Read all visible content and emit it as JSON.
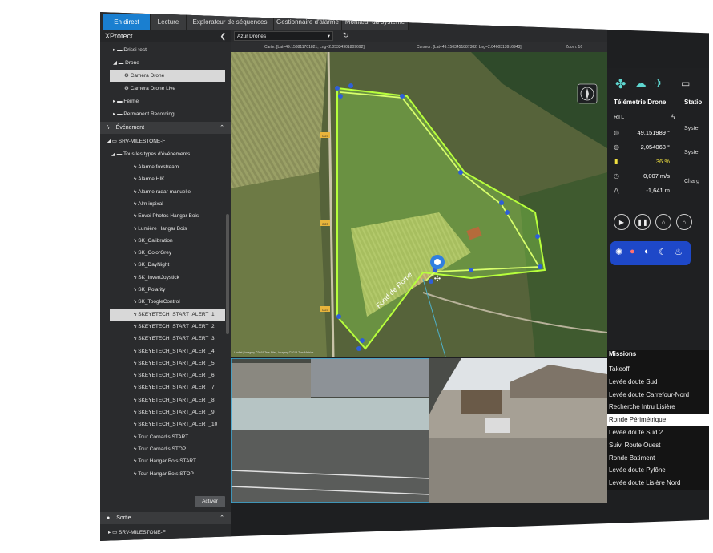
{
  "tabs": [
    "En direct",
    "Lecture",
    "Explorateur de séquences",
    "Gestionnaire d'alarme",
    "Moniteur du système"
  ],
  "app_title": "XProtect",
  "tree": {
    "top_items": [
      "Drissi test",
      "Drone",
      "Caméra Drone",
      "Caméra Drone Live",
      "Ferme",
      "Permanent Recording"
    ],
    "evenement_header": "Événement",
    "server": "SRV-MILESTONE-F",
    "all_events": "Tous les types d'événements",
    "events": [
      "Alarme foxstream",
      "Alarme HIK",
      "Alarme radar manuelle",
      "Alm inpixal",
      "Envoi Photos Hangar Bois",
      "Lumière Hangar Bois",
      "SK_Calibration",
      "SK_ColorGrey",
      "SK_DayNight",
      "SK_InvertJoystick",
      "SK_Polarity",
      "SK_ToogleControl",
      "SKEYETECH_START_ALERT_1",
      "SKEYETECH_START_ALERT_2",
      "SKEYETECH_START_ALERT_3",
      "SKEYETECH_START_ALERT_4",
      "SKEYETECH_START_ALERT_5",
      "SKEYETECH_START_ALERT_6",
      "SKEYETECH_START_ALERT_7",
      "SKEYETECH_START_ALERT_8",
      "SKEYETECH_START_ALERT_9",
      "SKEYETECH_START_ALERT_10",
      "Tour Cornadis START",
      "Tour Cornadis STOP",
      "Tour Hangar Bois START",
      "Tour Hangar Bois STOP"
    ],
    "activate_button": "Activer",
    "sortie_header": "Sortie",
    "sortie_server": "SRV-MILESTONE-F"
  },
  "map": {
    "view_select": "Azur Drones",
    "carte_coords": "Carte: [Lat=49.153811701821, Lng=2.05334901809692]",
    "curseur_coords": "Curseur: [Lat=49.1503451887382, Lng=2.0460313916943]",
    "zoom": "Zoom: 16",
    "road_label": "Fond de Rome",
    "road_badges": [
      "D23",
      "D23",
      "D23"
    ],
    "attribution": "Leaflet | Imagery ©2019 Tele Atlas, Imagery ©2019 TerraMetrics"
  },
  "telemetry": {
    "title": "Télémetrie Drone",
    "station_title": "Statio",
    "mode": "RTL",
    "latitude": "49,151989 °",
    "longitude": "2,054068 °",
    "battery": "36 %",
    "speed": "0,007 m/s",
    "altitude": "-1,641 m",
    "station_labels": [
      "Syste",
      "Syste",
      "Charg"
    ]
  },
  "missions": {
    "header": "Missions",
    "items": [
      "Takeoff",
      "Levée doute Sud",
      "Levée doute Carrefour-Nord",
      "Recherche Intru Lisière",
      "Ronde Périmétrique",
      "Levée doute Sud 2",
      "Suivi Route Ouest",
      "Ronde Batiment",
      "Levée doute Pylône",
      "Levée doute Lisière Nord"
    ],
    "selected_index": 4
  },
  "colors": {
    "accent": "#1a7fd0",
    "perimeter": "#b7ff3c",
    "battery": "#f0e040"
  }
}
